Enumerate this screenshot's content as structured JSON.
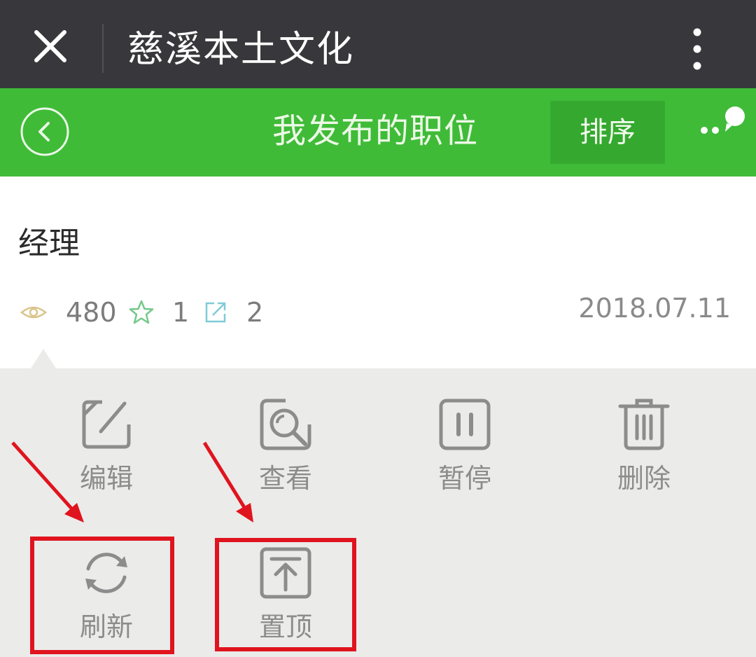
{
  "topbar": {
    "app_title": "慈溪本土文化"
  },
  "header": {
    "title": "我发布的职位",
    "sort_label": "排序"
  },
  "job": {
    "title": "经理",
    "views": "480",
    "favorites": "1",
    "shares": "2",
    "date": "2018.07.11"
  },
  "actions": {
    "edit": "编辑",
    "view": "查看",
    "pause": "暂停",
    "delete": "删除",
    "refresh": "刷新",
    "top": "置顶"
  },
  "colors": {
    "topbar_bg": "#38383c",
    "header_green": "#3fbb38",
    "sort_button": "#35a92f",
    "annotation_red": "#e0141e",
    "icon_gray": "#8c8c8c"
  },
  "icons": {
    "close": "close-icon",
    "more": "more-vertical-icon",
    "back": "back-circle-icon",
    "mini_program": "mini-program-menu-icon",
    "views": "eye-icon",
    "favorites": "star-icon",
    "shares": "share-icon",
    "edit": "edit-icon",
    "view": "magnifier-icon",
    "pause": "pause-icon",
    "delete": "trash-icon",
    "refresh": "refresh-icon",
    "top": "pin-top-icon"
  }
}
